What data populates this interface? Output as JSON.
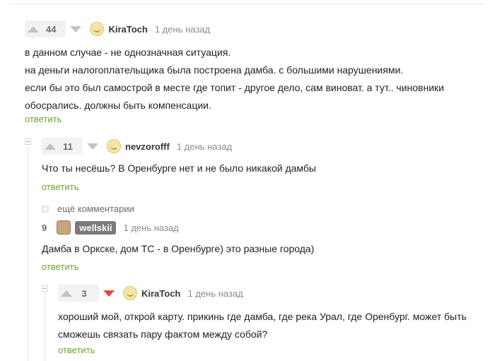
{
  "comments": [
    {
      "rating": "44",
      "author": "KiraToch",
      "time": "1 день назад",
      "lines": [
        "в данном случае - не однозначная ситуация.",
        "на деньги налогоплательщика была построена дамба. с большими нарушениями.",
        "если бы это был самострой в месте где топит - другое дело, сам виноват. а тут.. чиновники",
        "обосрались. должны быть компенсации."
      ],
      "reply": "ответить"
    },
    {
      "rating": "11",
      "author": "nevzorofff",
      "time": "1 день назад",
      "lines": [
        "Что ты несёшь? В Оренбурге нет и не было никакой дамбы"
      ],
      "reply": "ответить"
    },
    {
      "rating": "9",
      "author": "wellskii",
      "time": "1 день назад",
      "lines": [
        "Дамба в Оркске, дом ТС - в Оренбурге) это разные города)"
      ],
      "reply": "ответить"
    },
    {
      "rating": "3",
      "author": "KiraToch",
      "time": "1 день назад",
      "lines": [
        "хороший мой, открой карту. прикинь где дамба, где река Урал, где Оренбург. может быть",
        "сможешь связать пару фактом между собой?"
      ],
      "reply": "ответить"
    }
  ],
  "more_comments": "ещё комментарии",
  "colors": {
    "reply_link": "#6ea136",
    "downvote_active": "#e8443d",
    "vote_pill_bg": "#f2f2f2",
    "badge_bg": "#7a7a7a"
  },
  "icons": [
    "upvote-icon",
    "downvote-icon",
    "avatar-icon",
    "collapse-icon",
    "expand-icon"
  ]
}
